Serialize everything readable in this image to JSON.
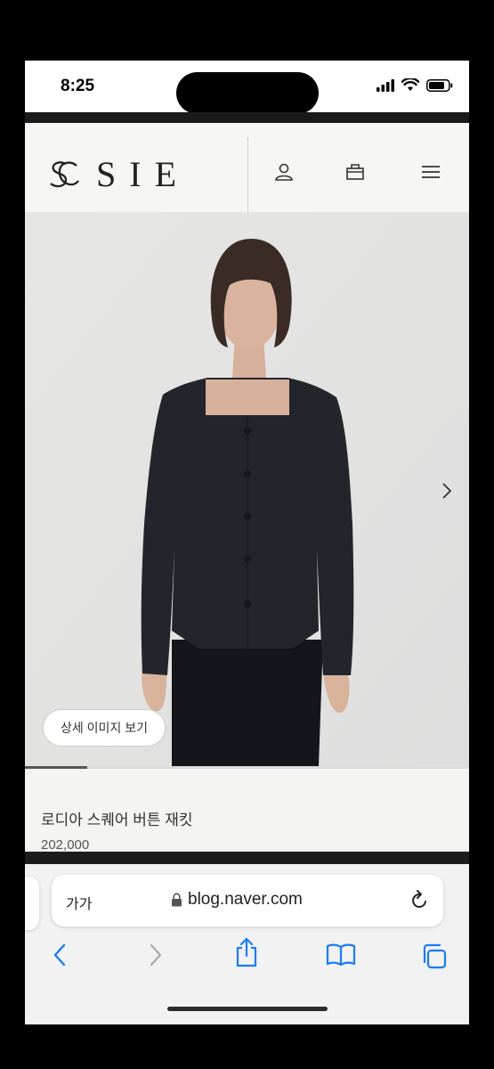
{
  "status_bar": {
    "time": "8:25"
  },
  "site": {
    "logo_text": "SIE",
    "icons": [
      "account-icon",
      "bag-icon",
      "menu-icon"
    ]
  },
  "product": {
    "detail_button_label": "상세 이미지 보기",
    "name": "로디아 스퀘어 버튼 재킷",
    "price": "202,000",
    "gallery_progress": 0.14
  },
  "browser": {
    "text_size_label": "가가",
    "url": "blog.naver.com",
    "toolbar_icons": [
      "back-icon",
      "forward-icon",
      "share-icon",
      "bookmarks-icon",
      "tabs-icon"
    ]
  },
  "colors": {
    "accent_link_blue": "#1a7cf5",
    "jacket": "#23252c",
    "background_page": "#f4f4f2"
  }
}
